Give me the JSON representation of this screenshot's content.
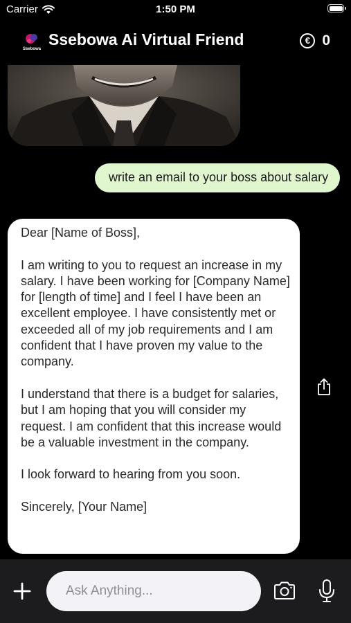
{
  "status_bar": {
    "carrier": "Carrier",
    "time": "1:50 PM"
  },
  "header": {
    "logo_text": "Ssebowa",
    "title": "Ssebowa Ai Virtual Friend",
    "coin_symbol": "€",
    "coin_count": "0"
  },
  "chat": {
    "user_message": "write an email to your boss about salary",
    "bot_message": {
      "greeting": "Dear [Name of Boss],",
      "paragraph1": "I am writing to you to request an increase in my salary. I have been working for [Company Name] for [length of time] and I feel I have been an excellent employee. I have consistently met or exceeded all of my job requirements and I am confident that I have proven my value to the company.",
      "paragraph2": "I understand that there is a budget for salaries, but I am hoping that you will consider my request. I am confident that this increase would be a valuable investment in the company.",
      "paragraph3": "I look forward to hearing from you soon.",
      "closing": "Sincerely,  [Your Name]"
    }
  },
  "input_bar": {
    "placeholder": "Ask Anything..."
  },
  "colors": {
    "background": "#000000",
    "user_bubble": "#dff6cf",
    "bot_bubble": "#ffffff",
    "input_bar": "#1c1c1e",
    "input_field": "#f2f2f7"
  }
}
